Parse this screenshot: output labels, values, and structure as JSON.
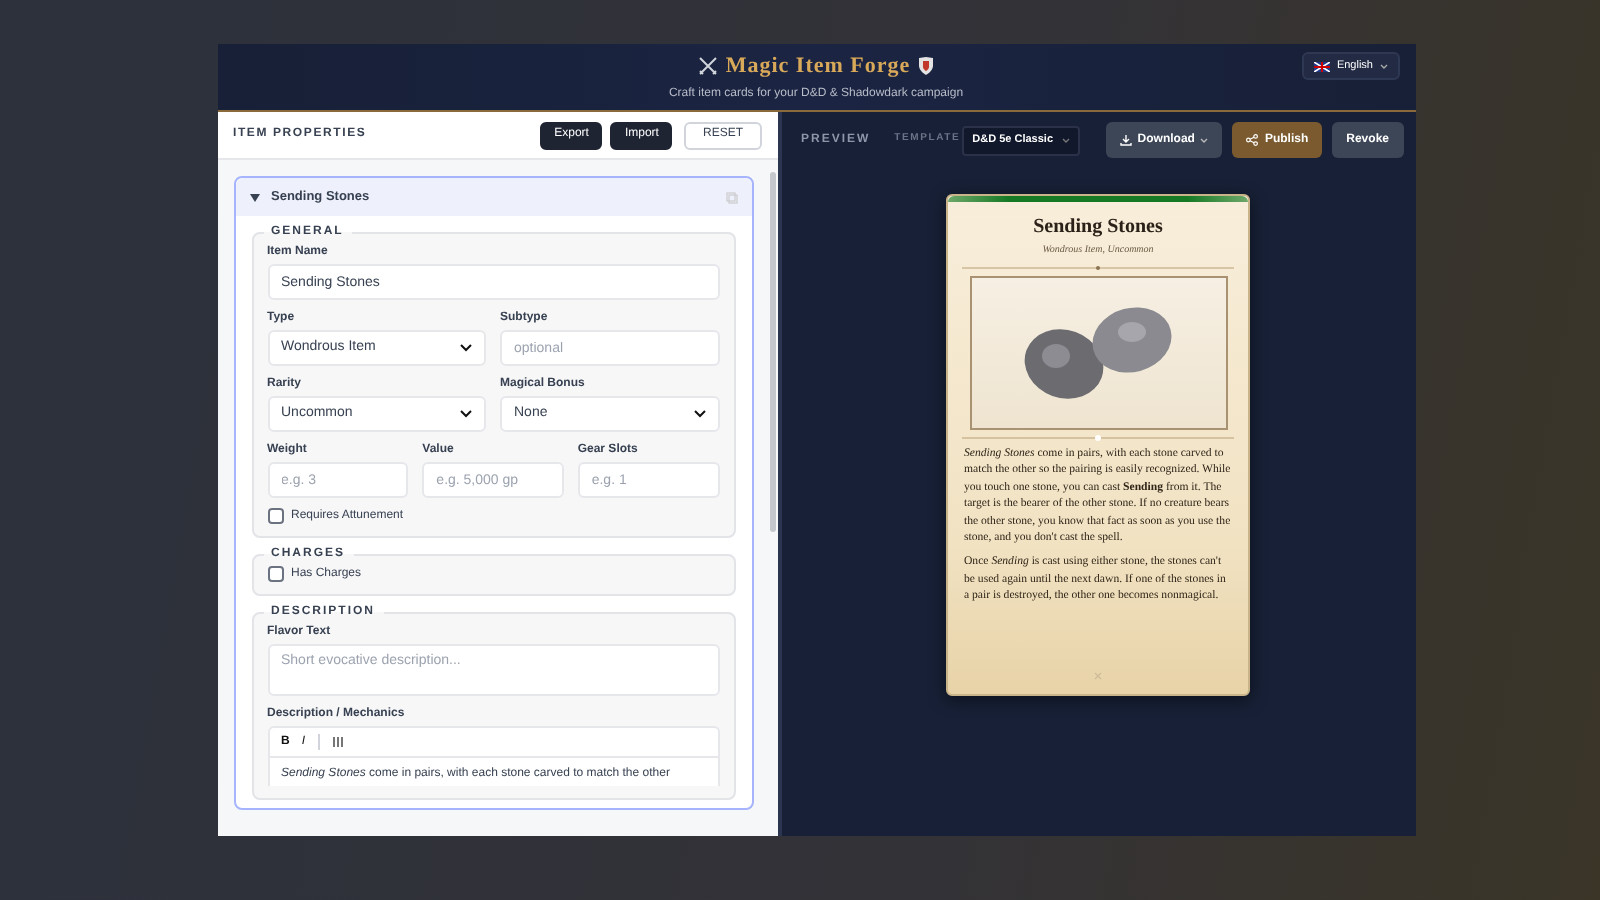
{
  "header": {
    "title": "Magic Item Forge",
    "subtitle": "Craft item cards for your D&D & Shadowdark campaign",
    "language": "English"
  },
  "properties": {
    "title": "ITEM PROPERTIES",
    "buttons": [
      {
        "label": "Export",
        "kind": "dark"
      },
      {
        "label": "Import",
        "kind": "dark"
      },
      {
        "label": "RESET",
        "kind": "outline"
      }
    ]
  },
  "item": {
    "name": "Sending Stones",
    "expanded": true,
    "sections": [
      {
        "legend": "GENERAL",
        "rows": [
          [
            {
              "kind": "text",
              "label": "Item Name",
              "value": "Sending Stones"
            }
          ],
          [
            {
              "kind": "select",
              "label": "Type",
              "value": "Wondrous Item"
            },
            {
              "kind": "text",
              "label": "Subtype",
              "placeholder": "optional"
            }
          ],
          [
            {
              "kind": "select",
              "label": "Rarity",
              "value": "Uncommon"
            },
            {
              "kind": "select",
              "label": "Magical Bonus",
              "value": "None"
            }
          ],
          [
            {
              "kind": "text",
              "label": "Weight",
              "placeholder": "e.g. 3"
            },
            {
              "kind": "text",
              "label": "Value",
              "placeholder": "e.g. 5,000 gp"
            },
            {
              "kind": "text",
              "label": "Gear Slots",
              "placeholder": "e.g. 1"
            }
          ],
          [
            {
              "kind": "checkbox",
              "label": "Requires Attunement",
              "checked": false
            }
          ]
        ]
      },
      {
        "legend": "CHARGES",
        "rows": [
          [
            {
              "kind": "checkbox",
              "label": "Has Charges",
              "checked": false
            }
          ]
        ]
      },
      {
        "legend": "DESCRIPTION",
        "rows": [
          [
            {
              "kind": "textarea",
              "label": "Flavor Text",
              "placeholder": "Short evocative description..."
            }
          ],
          [
            {
              "kind": "editor",
              "label": "Description / Mechanics",
              "tools": [
                "B",
                "I"
              ],
              "value": "*Sending Stones* come in pairs, with each stone carved to match the other"
            }
          ]
        ]
      }
    ]
  },
  "preview": {
    "label": "PREVIEW",
    "template_label": "TEMPLATE",
    "template": "D&D 5e Classic",
    "buttons": [
      {
        "label": "Download",
        "kind": "download"
      },
      {
        "label": "Publish",
        "kind": "publish"
      },
      {
        "label": "Revoke",
        "kind": "plain"
      }
    ]
  },
  "card": {
    "title": "Sending Stones",
    "subtitle": "Wondrous Item, Uncommon",
    "paragraphs": [
      "*Sending Stones* come in pairs, with each stone carved to match the other so the pairing is easily recognized. While you touch one stone, you can cast **Sending** from it. The target is the bearer of the other stone. If no creature bears the other stone, you know that fact as soon as you use the stone, and you don't cast the spell.",
      "Once *Sending* is cast using either stone, the stones can't be used again until the next dawn. If one of the stones in a pair is destroyed, the other one becomes nonmagical."
    ]
  }
}
